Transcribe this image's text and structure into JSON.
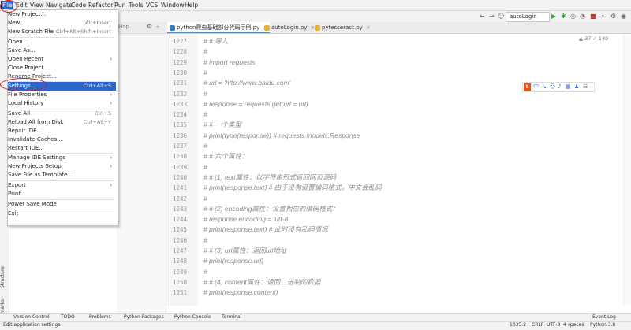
{
  "menubar": {
    "items": [
      "File",
      "Edit",
      "View",
      "Navigate",
      "Code",
      "Refactor",
      "Run",
      "Tools",
      "VCS",
      "Window",
      "Help"
    ]
  },
  "toolbar": {
    "run_config": "autoLogin"
  },
  "tabs": [
    {
      "label": "python爬虫基础部分代码示例.py",
      "active": true
    },
    {
      "label": "autoLogin.py",
      "active": false
    },
    {
      "label": "pytesseract.py",
      "active": false
    }
  ],
  "project_pane": {
    "header": "Hop"
  },
  "editor": {
    "counts": "▲ 37  ✓ 149",
    "lines": [
      {
        "num": "1227",
        "text": "# # 导入"
      },
      {
        "num": "1228",
        "text": "#"
      },
      {
        "num": "1229",
        "text": "# import requests"
      },
      {
        "num": "1230",
        "text": "#"
      },
      {
        "num": "1231",
        "text": "# url = 'http://www.baidu.com'"
      },
      {
        "num": "1232",
        "text": "#"
      },
      {
        "num": "1233",
        "text": "# response = requests.get(url = url)"
      },
      {
        "num": "1234",
        "text": "#"
      },
      {
        "num": "1235",
        "text": "# # 一个类型"
      },
      {
        "num": "1236",
        "text": "# print(type(response)) # requests.models.Response"
      },
      {
        "num": "1237",
        "text": "#"
      },
      {
        "num": "1238",
        "text": "# # 六个属性："
      },
      {
        "num": "1239",
        "text": "#"
      },
      {
        "num": "1240",
        "text": "# # (1) text属性：以字符串形式返回网页源码"
      },
      {
        "num": "1241",
        "text": "# print(response.text) # 由于没有设置编码格式，中文会乱码"
      },
      {
        "num": "1242",
        "text": "#"
      },
      {
        "num": "1243",
        "text": "# # (2) encoding属性：设置相应的编码格式："
      },
      {
        "num": "1244",
        "text": "# response.encoding = 'utf-8'"
      },
      {
        "num": "1245",
        "text": "# print(response.text) # 此时没有乱码情况"
      },
      {
        "num": "1246",
        "text": "#"
      },
      {
        "num": "1247",
        "text": "# # (3) url属性：返回url地址"
      },
      {
        "num": "1248",
        "text": "# print(response.url)"
      },
      {
        "num": "1249",
        "text": "#"
      },
      {
        "num": "1250",
        "text": "# # (4) content属性：返回二进制的数据"
      },
      {
        "num": "1251",
        "text": "# print(response.content)"
      }
    ]
  },
  "file_menu": {
    "items": [
      {
        "label": "New Project...",
        "shortcut": "",
        "arrow": false
      },
      {
        "label": "New...",
        "shortcut": "Alt+Insert",
        "arrow": false
      },
      {
        "label": "New Scratch File",
        "shortcut": "Ctrl+Alt+Shift+Insert",
        "arrow": false
      },
      {
        "sep": true
      },
      {
        "label": "Open...",
        "shortcut": "",
        "arrow": false
      },
      {
        "label": "Save As...",
        "shortcut": "",
        "arrow": false
      },
      {
        "label": "Open Recent",
        "shortcut": "",
        "arrow": true
      },
      {
        "label": "Close Project",
        "shortcut": "",
        "arrow": false
      },
      {
        "label": "Rename Project...",
        "shortcut": "",
        "arrow": false
      },
      {
        "sep": true
      },
      {
        "label": "Settings...",
        "shortcut": "Ctrl+Alt+S",
        "arrow": false,
        "selected": true
      },
      {
        "label": "File Properties",
        "shortcut": "",
        "arrow": true
      },
      {
        "label": "Local History",
        "shortcut": "",
        "arrow": true
      },
      {
        "sep": true
      },
      {
        "label": "Save All",
        "shortcut": "Ctrl+S",
        "arrow": false
      },
      {
        "label": "Reload All from Disk",
        "shortcut": "Ctrl+Alt+Y",
        "arrow": false
      },
      {
        "label": "Repair IDE...",
        "shortcut": "",
        "arrow": false
      },
      {
        "label": "Invalidate Caches...",
        "shortcut": "",
        "arrow": false
      },
      {
        "label": "Restart IDE...",
        "shortcut": "",
        "arrow": false
      },
      {
        "sep": true
      },
      {
        "label": "Manage IDE Settings",
        "shortcut": "",
        "arrow": true
      },
      {
        "label": "New Projects Setup",
        "shortcut": "",
        "arrow": true
      },
      {
        "label": "Save File as Template...",
        "shortcut": "",
        "arrow": false
      },
      {
        "sep": true
      },
      {
        "label": "Export",
        "shortcut": "",
        "arrow": true
      },
      {
        "label": "Print...",
        "shortcut": "",
        "arrow": false
      },
      {
        "sep": true
      },
      {
        "label": "Power Save Mode",
        "shortcut": "",
        "arrow": false
      },
      {
        "sep": true
      },
      {
        "label": "Exit",
        "shortcut": "",
        "arrow": false
      }
    ]
  },
  "left_strip": {
    "structure": "Structure",
    "bookmarks": "Bookmarks"
  },
  "bottom_tools": [
    "Version Control",
    "TODO",
    "Problems",
    "Python Packages",
    "Python Console",
    "Terminal"
  ],
  "event_log": "Event Log",
  "status": {
    "message": "Edit application settings",
    "position": "1035:2",
    "line_sep": "CRLF",
    "encoding": "UTF-8",
    "indent": "4 spaces",
    "interpreter": "Python 3.8"
  },
  "sogou": {
    "label": "S"
  }
}
